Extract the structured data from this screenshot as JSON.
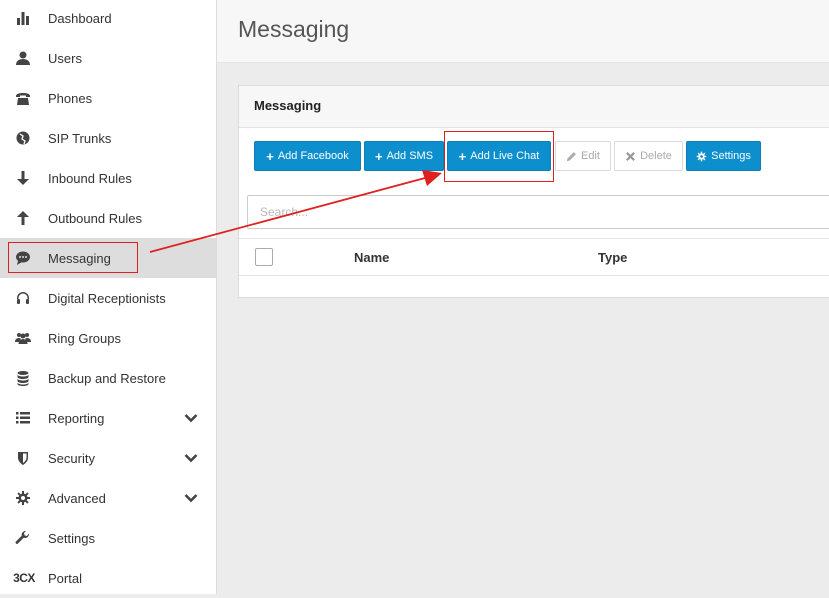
{
  "sidebar": {
    "items": [
      {
        "label": "Dashboard",
        "icon": "bar-chart-icon"
      },
      {
        "label": "Users",
        "icon": "user-icon"
      },
      {
        "label": "Phones",
        "icon": "phone-icon"
      },
      {
        "label": "SIP Trunks",
        "icon": "globe-icon"
      },
      {
        "label": "Inbound Rules",
        "icon": "arrow-down-icon"
      },
      {
        "label": "Outbound Rules",
        "icon": "arrow-up-icon"
      },
      {
        "label": "Messaging",
        "icon": "chat-bubble-icon"
      },
      {
        "label": "Digital Receptionists",
        "icon": "headset-icon"
      },
      {
        "label": "Ring Groups",
        "icon": "group-icon"
      },
      {
        "label": "Backup and Restore",
        "icon": "database-icon"
      },
      {
        "label": "Reporting",
        "icon": "list-icon"
      },
      {
        "label": "Security",
        "icon": "shield-icon"
      },
      {
        "label": "Advanced",
        "icon": "gear-icon"
      },
      {
        "label": "Settings",
        "icon": "wrench-icon"
      },
      {
        "label": "Portal",
        "icon": "3cx-logo"
      }
    ],
    "logo_text": "3CX"
  },
  "header": {
    "title": "Messaging"
  },
  "panel": {
    "title": "Messaging",
    "toolbar": {
      "add_facebook": "Add Facebook",
      "add_sms": "Add SMS",
      "add_live_chat": "Add Live Chat",
      "edit": "Edit",
      "delete": "Delete",
      "settings": "Settings"
    },
    "search_placeholder": "Search...",
    "columns": [
      "Name",
      "Type"
    ]
  },
  "colors": {
    "primary": "#0e8fcd",
    "annotation": "#e02020",
    "active_nav": "#dddddd"
  }
}
